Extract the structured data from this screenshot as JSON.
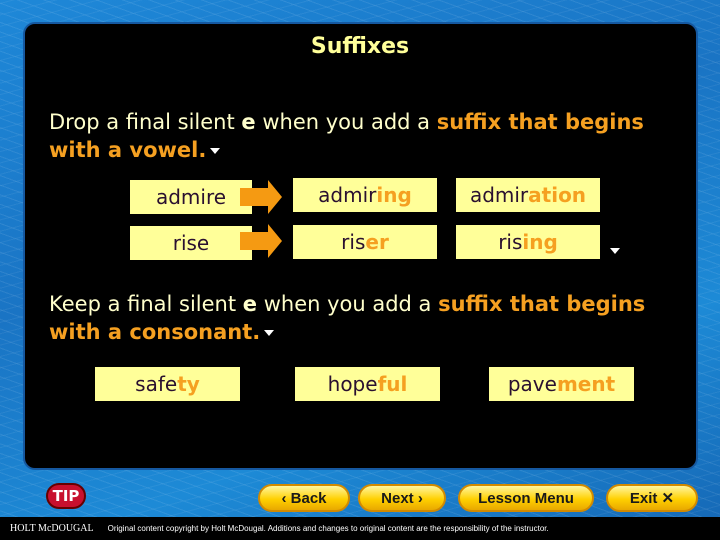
{
  "title": "Suffixes",
  "rule1": {
    "pre": "Drop a final silent ",
    "letter": "e",
    "mid": " when you add a ",
    "highlight": "suffix that begins with a vowel."
  },
  "rule2": {
    "pre": "Keep a final silent ",
    "letter": "e",
    "mid": " when you add a ",
    "highlight": "suffix that begins with a consonant."
  },
  "rows": [
    {
      "base": "admire",
      "words": [
        {
          "stem": "admir",
          "suffix": "ing"
        },
        {
          "stem": "admir",
          "suffix": "ation"
        }
      ]
    },
    {
      "base": "rise",
      "words": [
        {
          "stem": "ris",
          "suffix": "er"
        },
        {
          "stem": "ris",
          "suffix": "ing"
        }
      ]
    }
  ],
  "consonant_words": [
    {
      "stem": "safe",
      "suffix": "ty"
    },
    {
      "stem": "hope",
      "suffix": "ful"
    },
    {
      "stem": "pave",
      "suffix": "ment"
    }
  ],
  "nav": {
    "tip": "TIP",
    "back": "‹ Back",
    "next": "Next ›",
    "menu": "Lesson Menu",
    "exit": "Exit ✕"
  },
  "footer": {
    "brand": "HOLT McDOUGAL",
    "copyright": "Original content copyright by Holt McDougal. Additions and changes to original content are the responsibility of the instructor."
  }
}
